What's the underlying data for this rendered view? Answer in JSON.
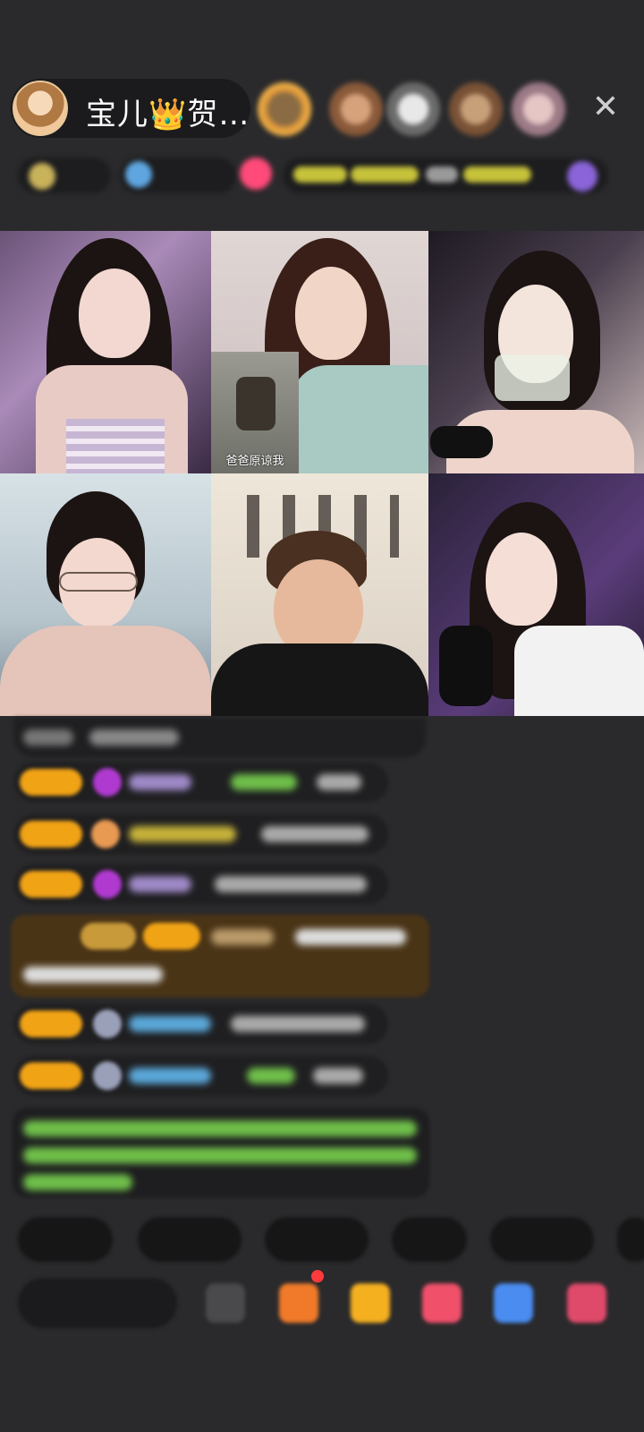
{
  "host": {
    "name": "宝儿👑贺…"
  },
  "close": {
    "glyph": "✕"
  },
  "grid": {
    "cells": [
      {
        "bg": "#b9a7c4"
      },
      {
        "bg": "#d5c8c7",
        "pip_caption": "爸爸原谅我"
      },
      {
        "bg": "#3b3340"
      },
      {
        "bg": "#cfd8de"
      },
      {
        "bg": "#d8cfc5"
      },
      {
        "bg": "#4b3b66"
      }
    ]
  },
  "colors": {
    "badge": "#f1a316",
    "highlight": "#4a3416",
    "notice_text": "#6fbf4a",
    "name_blue": "#5aa7d8",
    "name_purple": "#a08ac8"
  }
}
